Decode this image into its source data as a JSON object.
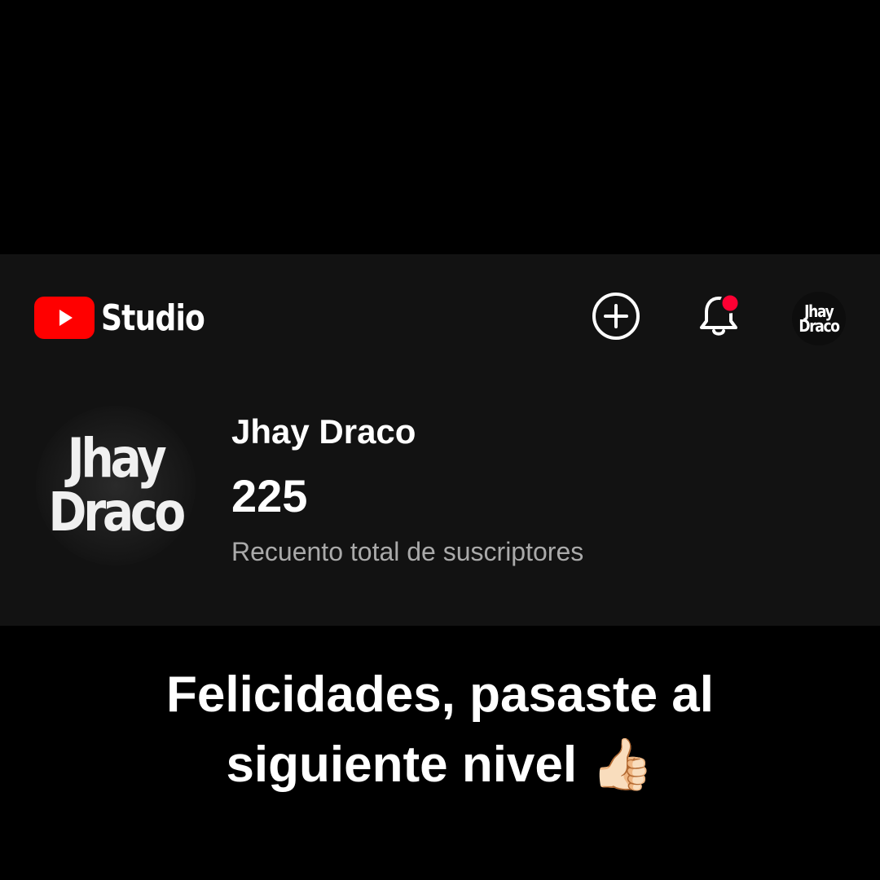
{
  "header": {
    "logo_icon": "youtube-play-icon",
    "logo_text": "Studio",
    "create_icon": "plus-circle-icon",
    "notifications_icon": "bell-icon",
    "notifications_badge_color": "#ff0033",
    "avatar_line1": "Jhay",
    "avatar_line2": "Draco"
  },
  "channel": {
    "avatar_line1": "Jhay",
    "avatar_line2": "Draco",
    "name": "Jhay Draco",
    "subscriber_count": "225",
    "subscriber_label": "Recuento total de suscriptores"
  },
  "caption": {
    "line1": "Felicidades, pasaste al",
    "line2": "siguiente nivel 👍🏻"
  },
  "colors": {
    "background": "#000000",
    "card": "#121212",
    "brand_red": "#ff0000",
    "text_primary": "#ffffff",
    "text_secondary": "#aaaaaa"
  }
}
